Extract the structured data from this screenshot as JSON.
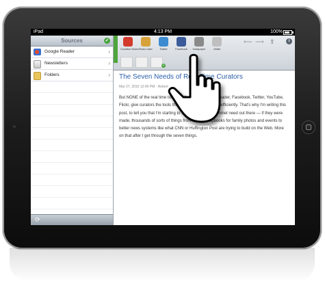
{
  "status_bar": {
    "carrier": "iPad",
    "time": "4:13 PM",
    "battery": "100%",
    "battery_level": 1.0
  },
  "sidebar": {
    "title": "Sources",
    "items": [
      {
        "label": "Google Reader",
        "icon": "google-reader-icon"
      },
      {
        "label": "Newsletters",
        "icon": "newsletter-icon"
      },
      {
        "label": "Folders",
        "icon": "folder-icon"
      }
    ]
  },
  "toolbar": {
    "share_items": [
      {
        "label": "Curation Notes",
        "color": "#d33a2c"
      },
      {
        "label": "Read Later",
        "color": "#d8a23a"
      },
      {
        "label": "Twitter",
        "color": "#3d8bd1"
      },
      {
        "label": "Facebook",
        "color": "#3b5b9a"
      },
      {
        "label": "Instapaper",
        "color": "#8a8a8a"
      },
      {
        "label": "eMail",
        "color": "#bfbfbf"
      }
    ]
  },
  "article": {
    "title": "The Seven Needs of Real-Time Curators",
    "meta": "Mar 27, 2010 12:45 PM · Robert",
    "body": "But NONE of the real time tools out there like Google Reader, Facebook, Twitter, YouTube, Flickr, give curators the tools they need to do their work efficiently. That's why I'm writing this post, to tell you that I'm starting to see that there's an unmet need out there — if they were made, thousands of sorts of things from better scrapbooks for family photos and events to better news systems like what CNN or Huffington Post are trying to build on the Web. More on that after I get through the seven things."
  }
}
